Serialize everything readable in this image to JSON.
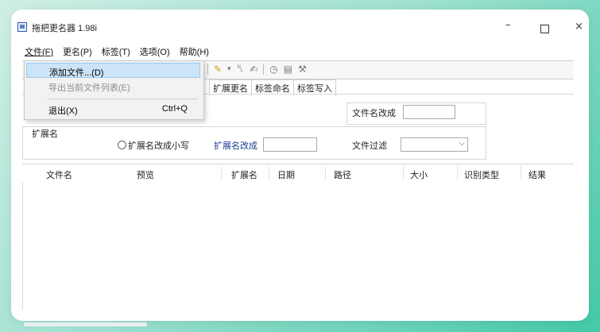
{
  "window": {
    "title": "拖把更名器 1.98i",
    "min_glyph": "–",
    "close_glyph": "×"
  },
  "menubar": [
    "文件(F)",
    "更名(P)",
    "标签(T)",
    "选项(O)",
    "帮助(H)"
  ],
  "file_menu": {
    "items": [
      {
        "label": "添加文件...(D)",
        "shortcut": "",
        "state": "highlighted"
      },
      {
        "label": "导出当前文件列表(E)",
        "shortcut": "",
        "state": "disabled"
      },
      {
        "label": "退出(X)",
        "shortcut": "Ctrl+Q",
        "state": "normal"
      }
    ]
  },
  "toolbar": {
    "icons": [
      "brush-icon",
      "dropdown-arrow-icon",
      "rename-files-icon",
      "rename-ext-icon",
      "history-icon",
      "preview-icon",
      "tools-icon"
    ]
  },
  "tabs": [
    "扩展更名",
    "标签命名",
    "标签写入"
  ],
  "form": {
    "filename_change_label": "文件名改成",
    "filename_change_value": "",
    "ext_group_label": "扩展名",
    "ext_lowercase_label": "扩展名改成小写",
    "ext_change_label": "扩展名改成",
    "ext_change_value": "",
    "file_filter_label": "文件过滤",
    "file_filter_value": ""
  },
  "table": {
    "columns": [
      "文件名",
      "预览",
      "扩展名",
      "日期",
      "路径",
      "大小",
      "识别类型",
      "结果"
    ],
    "rows": []
  },
  "colors": {
    "background_gradient_end": "#44c9a6",
    "menu_highlight": "#cce4f7",
    "link_blue": "#1a3c8f"
  }
}
